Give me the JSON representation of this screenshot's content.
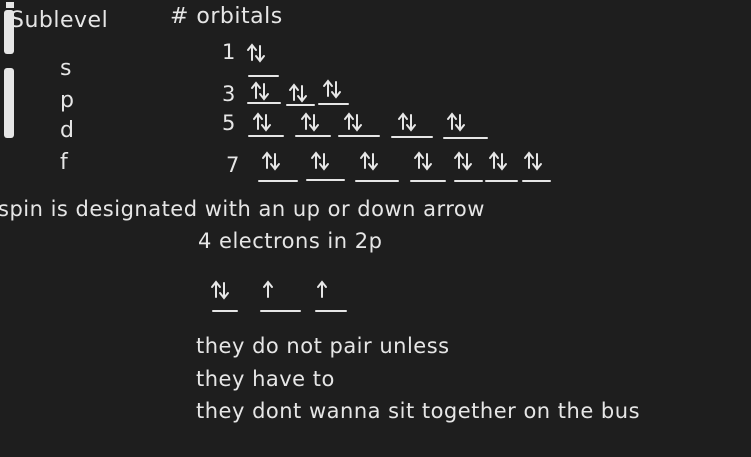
{
  "header": {
    "sublevel": "Sublevel",
    "orbitals": "# orbitals"
  },
  "rows": [
    {
      "sublevel": "s",
      "count": "1"
    },
    {
      "sublevel": "p",
      "count": "3"
    },
    {
      "sublevel": "d",
      "count": "5"
    },
    {
      "sublevel": "f",
      "count": "7"
    }
  ],
  "spin_note": "spin is designated with an up or down arrow",
  "electrons_note": "4 electrons in 2p",
  "hund_lines": [
    "they do not pair unless",
    "they have to",
    "they dont wanna sit together on the bus"
  ],
  "colors": {
    "background": "#1e1e1e",
    "ink": "#e6e6e6"
  }
}
